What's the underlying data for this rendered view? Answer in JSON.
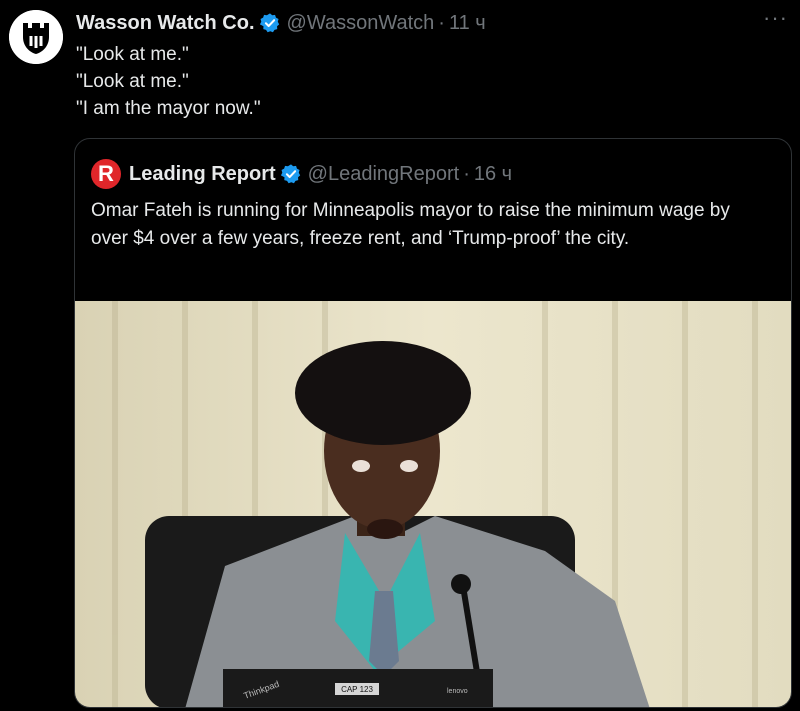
{
  "tweet": {
    "author_name": "Wasson Watch Co.",
    "author_handle": "@WassonWatch",
    "separator": "·",
    "time": "11 ч",
    "more_label": "···",
    "lines": [
      "\"Look at me.\"",
      "\"Look at me.\"",
      "\"I am the mayor now.\""
    ]
  },
  "quote": {
    "avatar_letter": "R",
    "author_name": "Leading Report",
    "author_handle": "@LeadingReport",
    "separator": "·",
    "time": "16 ч",
    "text": "Omar Fateh is running for Minneapolis mayor to raise the minimum wage by over $4 over a few years, freeze rent, and ‘Trump-proof’ the city.",
    "image": {
      "nameplate": "CAP 123",
      "laptop_brand": "Thinkpad",
      "laptop_brand_right": "lenovo"
    }
  },
  "colors": {
    "background": "#000000",
    "text": "#e7e9ea",
    "muted": "#71767b",
    "verified": "#1d9bf0",
    "quote_avatar": "#e0262a"
  },
  "icons": {
    "verified": "verified-badge-icon",
    "more": "more-options-icon",
    "avatar": "castle-logo-icon"
  }
}
